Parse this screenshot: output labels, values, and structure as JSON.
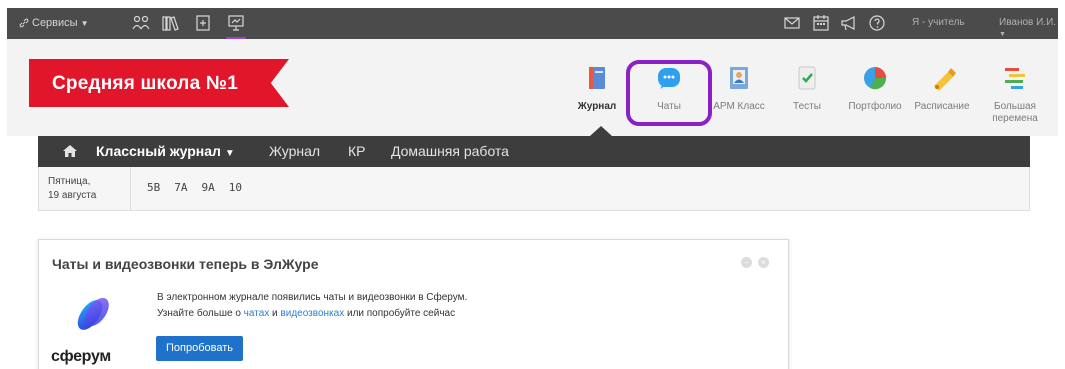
{
  "topbar": {
    "services_label": "Сервисы",
    "role": "Я - учитель",
    "user": "Иванов И.И.",
    "icons_left": [
      "people-icon",
      "books-icon",
      "document-icon",
      "presentation-icon"
    ],
    "icons_right": [
      "mail-icon",
      "calendar-icon",
      "megaphone-icon",
      "help-icon"
    ]
  },
  "header": {
    "school": "Средняя школа №1",
    "apps": [
      {
        "label": "Журнал",
        "icon": "journal-icon",
        "active": true
      },
      {
        "label": "Чаты",
        "icon": "chat-icon",
        "highlighted": true
      },
      {
        "label": "АРМ Класс",
        "icon": "arm-class-icon"
      },
      {
        "label": "Тесты",
        "icon": "tests-icon"
      },
      {
        "label": "Портфолио",
        "icon": "portfolio-icon"
      },
      {
        "label": "Расписание",
        "icon": "schedule-icon"
      },
      {
        "label": "Большая перемена",
        "icon": "big-break-icon"
      }
    ],
    "accent": "#e2162a",
    "highlight": "#8a20c8"
  },
  "nav": {
    "items": [
      {
        "label": "Классный журнал",
        "bold": true
      },
      {
        "label": "Журнал"
      },
      {
        "label": "КР"
      },
      {
        "label": "Домашняя работа"
      }
    ]
  },
  "daterow": {
    "day": "Пятница,",
    "date": "19 августа",
    "classes": [
      "5В",
      "7А",
      "9А",
      "10"
    ]
  },
  "card": {
    "title": "Чаты и видеозвонки теперь в ЭлЖуре",
    "line1": "В электронном журнале появились чаты и видеозвонки в Сферум.",
    "line2_prefix": "Узнайте больше о ",
    "link_chats": "чатах",
    "line2_and": " и ",
    "link_calls": "видеозвонках",
    "line2_suffix": " или попробуйте сейчас",
    "button": "Попробовать",
    "brand": "сферум",
    "button_color": "#1e72c9"
  }
}
